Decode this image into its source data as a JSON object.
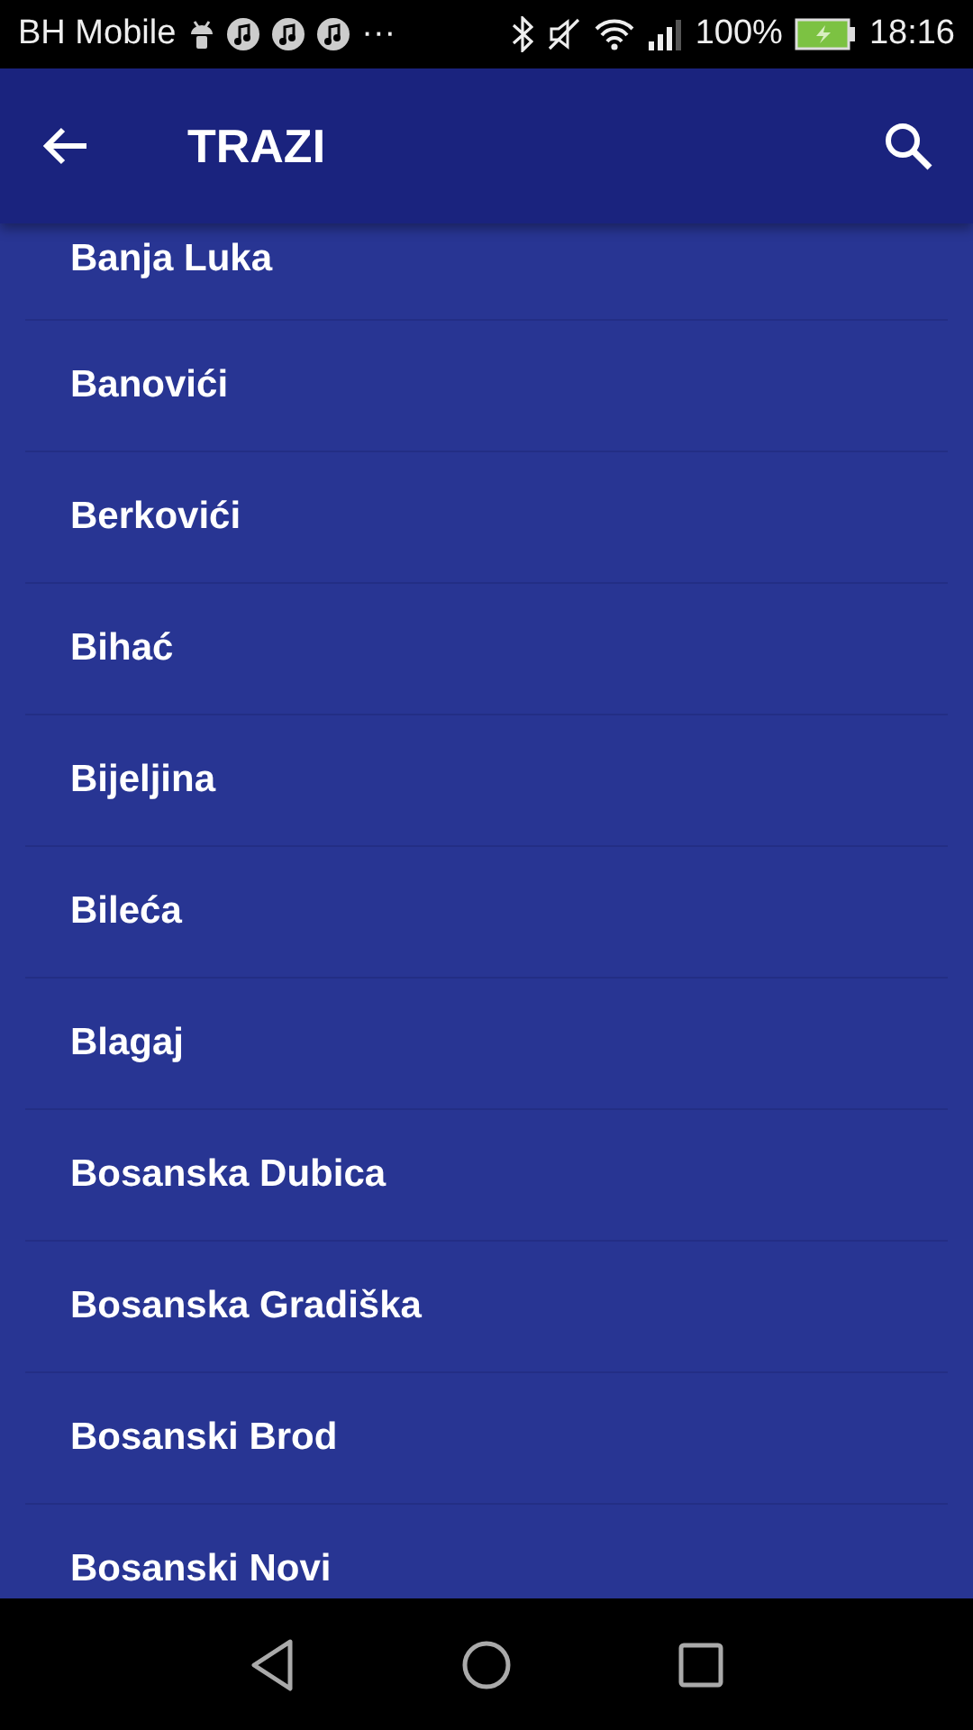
{
  "status_bar": {
    "carrier": "BH Mobile",
    "overflow": "···",
    "battery": "100%",
    "time": "18:16"
  },
  "app_bar": {
    "title": "TRAZI"
  },
  "cities": [
    {
      "name": "Banja Luka"
    },
    {
      "name": "Banovići"
    },
    {
      "name": "Berkovići"
    },
    {
      "name": "Bihać"
    },
    {
      "name": "Bijeljina"
    },
    {
      "name": "Bileća"
    },
    {
      "name": "Blagaj"
    },
    {
      "name": "Bosanska Dubica"
    },
    {
      "name": "Bosanska Gradiška"
    },
    {
      "name": "Bosanski Brod"
    },
    {
      "name": "Bosanski Novi"
    }
  ]
}
